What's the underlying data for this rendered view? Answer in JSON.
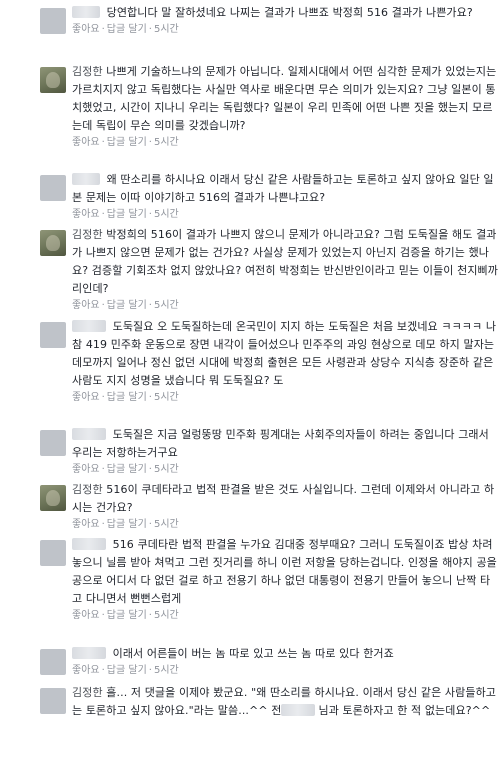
{
  "comments": [
    {
      "author": "",
      "author_hidden": true,
      "avatar_style": "grey",
      "text": "당연합니다 말 잘하셨네요 나찌는 결과가 나쁘죠 박정희 516 결과가 나쁜가요?",
      "like": "좋아요",
      "reply": "답글 달기",
      "time": "5시간"
    },
    {
      "author": "김정한",
      "author_hidden": false,
      "avatar_style": "olive",
      "text": "나쁘게 기술하느냐의 문제가 아닙니다. 일제시대에서 어떤 심각한 문제가 있었는지는 가르치지지 않고 독립했다는 사실만 역사로 배운다면 무슨 의미가 있는지요? 그냥 일본이 통치했었고, 시간이 지나니 우리는 독립했다? 일본이 우리 민족에 어떤 나쁜 짓을 했는지 모르는데 독립이 무슨 의미를 갖겠습니까?",
      "like": "좋아요",
      "reply": "답글 달기",
      "time": "5시간"
    },
    {
      "author": "",
      "author_hidden": true,
      "avatar_style": "grey",
      "text": "왜 딴소리를 하시나요 이래서 당신 같은 사람들하고는 토론하고 싶지 않아요 일단 일본 문제는 이따 이야기하고 516의 결과가 나쁜냐고요?",
      "like": "좋아요",
      "reply": "답글 달기",
      "time": "5시간"
    },
    {
      "author": "김정한",
      "author_hidden": false,
      "avatar_style": "olive",
      "text": "박정희의 516이 결과가 나쁘지 않으니 문제가 아니라고요? 그럼 도둑질을 해도 결과가 나쁘지 않으면 문제가 없는 건가요? 사실상 문제가 있었는지 아닌지 검증을 하기는 했나요? 검증할 기회조차 없지 않았나요? 여전히 박정희는 반신반인이라고 믿는 이들이 천지삐까리인데?",
      "like": "좋아요",
      "reply": "답글 달기",
      "time": "5시간"
    },
    {
      "author": "",
      "author_hidden": true,
      "avatar_style": "grey",
      "text": "도둑질요 오 도둑질하는데 온국민이 지지 하는 도둑질은 처음 보겠네요 ㅋㅋㅋㅋ 나참 419 민주화 운동으로 장면 내각이 들어섰으나 민주주의 과잉 현상으로 데모 하지 말자는 데모까지 일어나 정신 없던 시대에 박정희 출현은 모든 사령관과 상당수 지식층 장준하 같은 사람도 지지 성명을 냈습니다 뭐 도둑질요? 도",
      "like": "좋아요",
      "reply": "답글 달기",
      "time": "5시간"
    },
    {
      "author": "",
      "author_hidden": true,
      "avatar_style": "grey",
      "text": "도둑질은 지금 얼렁뚱땅 민주화 핑계대는 사회주의자들이 하려는 중입니다 그래서 우리는 저항하는거구요",
      "like": "좋아요",
      "reply": "답글 달기",
      "time": "5시간"
    },
    {
      "author": "김정한",
      "author_hidden": false,
      "avatar_style": "olive",
      "text": "516이 쿠데타라고 법적 판결을 받은 것도 사실입니다. 그런데 이제와서 아니라고 하시는 건가요?",
      "like": "좋아요",
      "reply": "답글 달기",
      "time": "5시간"
    },
    {
      "author": "",
      "author_hidden": true,
      "avatar_style": "grey",
      "text": "516 쿠데타란 법적 판결을 누가요 김대중 정부때요? 그러니 도둑질이죠 밥상 차려 놓으니 닐름 받아 쳐먹고 그런 짓거리를 하니 이런 저항을 당하는겁니다. 인정을 해야지 공을 공으로 어디서 다 없던 걸로 하고 전용기 하나 없던 대통령이 전용기 만들어 놓으니 난짝 타고 다니면서 뻔뻔스럽게",
      "like": "좋아요",
      "reply": "답글 달기",
      "time": "5시간"
    },
    {
      "author": "",
      "author_hidden": true,
      "avatar_style": "grey",
      "text": "이래서 어른들이 버는 놈 따로 있고 쓰는 놈 따로 있다 한거죠",
      "like": "좋아요",
      "reply": "답글 달기",
      "time": "5시간"
    },
    {
      "author": "김정한",
      "author_hidden": false,
      "avatar_style": "grey",
      "text": "흘... 저 댓글을 이제야 봤군요. \"왜 딴소리를 하시나요. 이래서 당신 같은 사람들하고는 토론하고 싶지 않아요.\"라는 말씀...^^ 전",
      "text_after": "님과 토론하자고 한 적 없는데요?^^",
      "like": "",
      "reply": "",
      "time": ""
    }
  ]
}
